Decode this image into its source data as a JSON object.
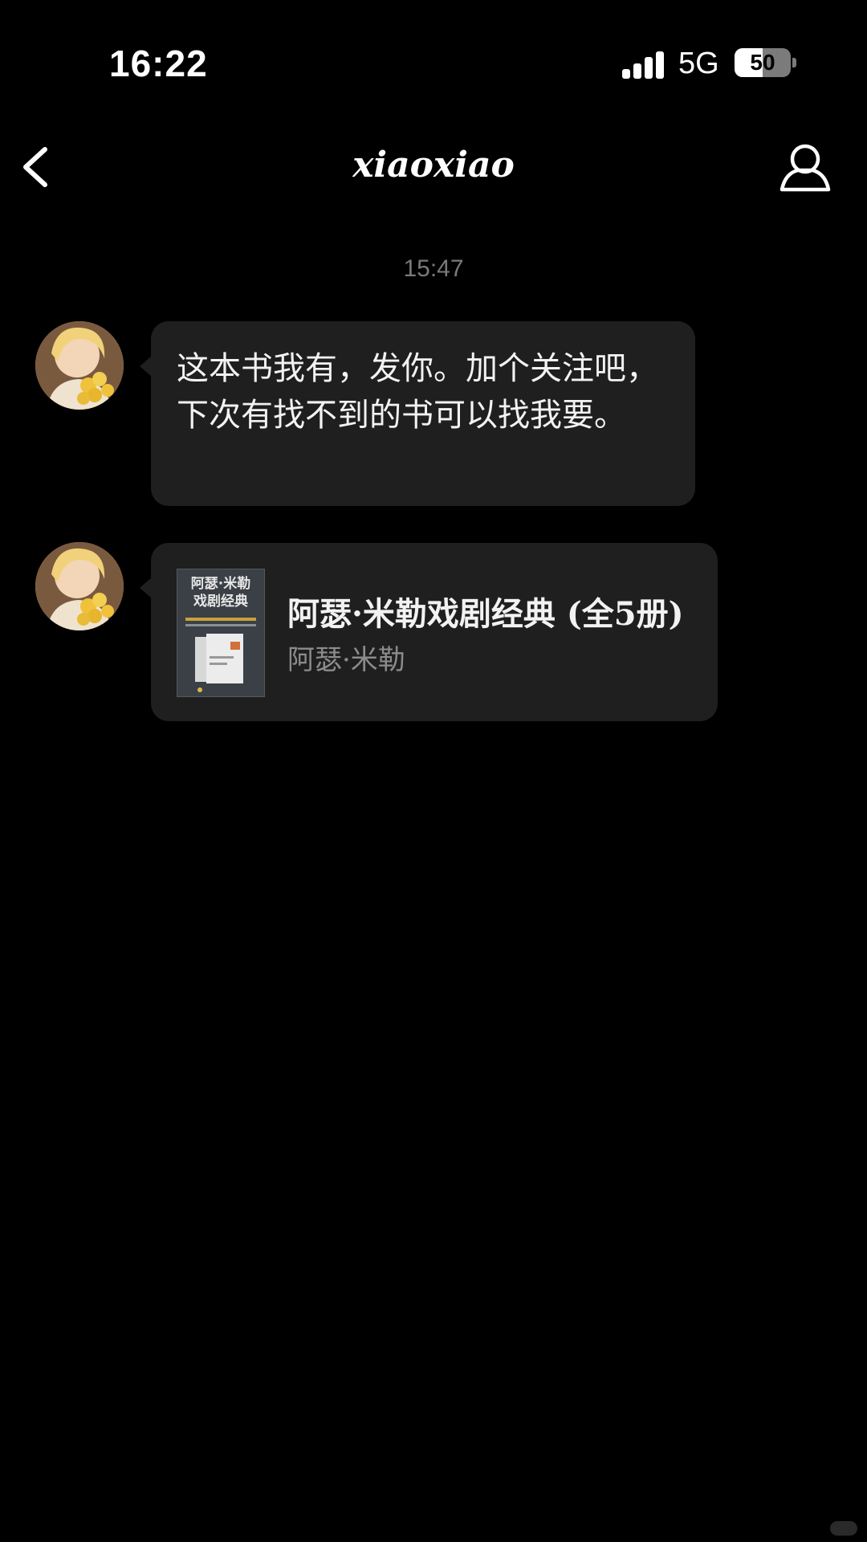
{
  "status_bar": {
    "time": "16:22",
    "network": "5G",
    "battery_text": "50",
    "battery_level": 0.5
  },
  "nav": {
    "title": "xiaoxiao",
    "back_icon": "chevron-left-icon",
    "profile_icon": "person-outline-icon"
  },
  "chat": {
    "timestamp": "15:47",
    "messages": [
      {
        "type": "text",
        "text": "这本书我有，发你。加个关注吧，下次有找不到的书可以找我要。"
      },
      {
        "type": "book_card",
        "title": "阿瑟·米勒戏剧经典 (全5册)",
        "author": "阿瑟·米勒",
        "cover_lines": [
          "阿瑟·米勒",
          "戏剧经典"
        ]
      }
    ]
  },
  "colors": {
    "background": "#000000",
    "bubble": "#1f1f1f",
    "secondary_text": "#8c8c8c",
    "timestamp": "#7a7a7a"
  }
}
